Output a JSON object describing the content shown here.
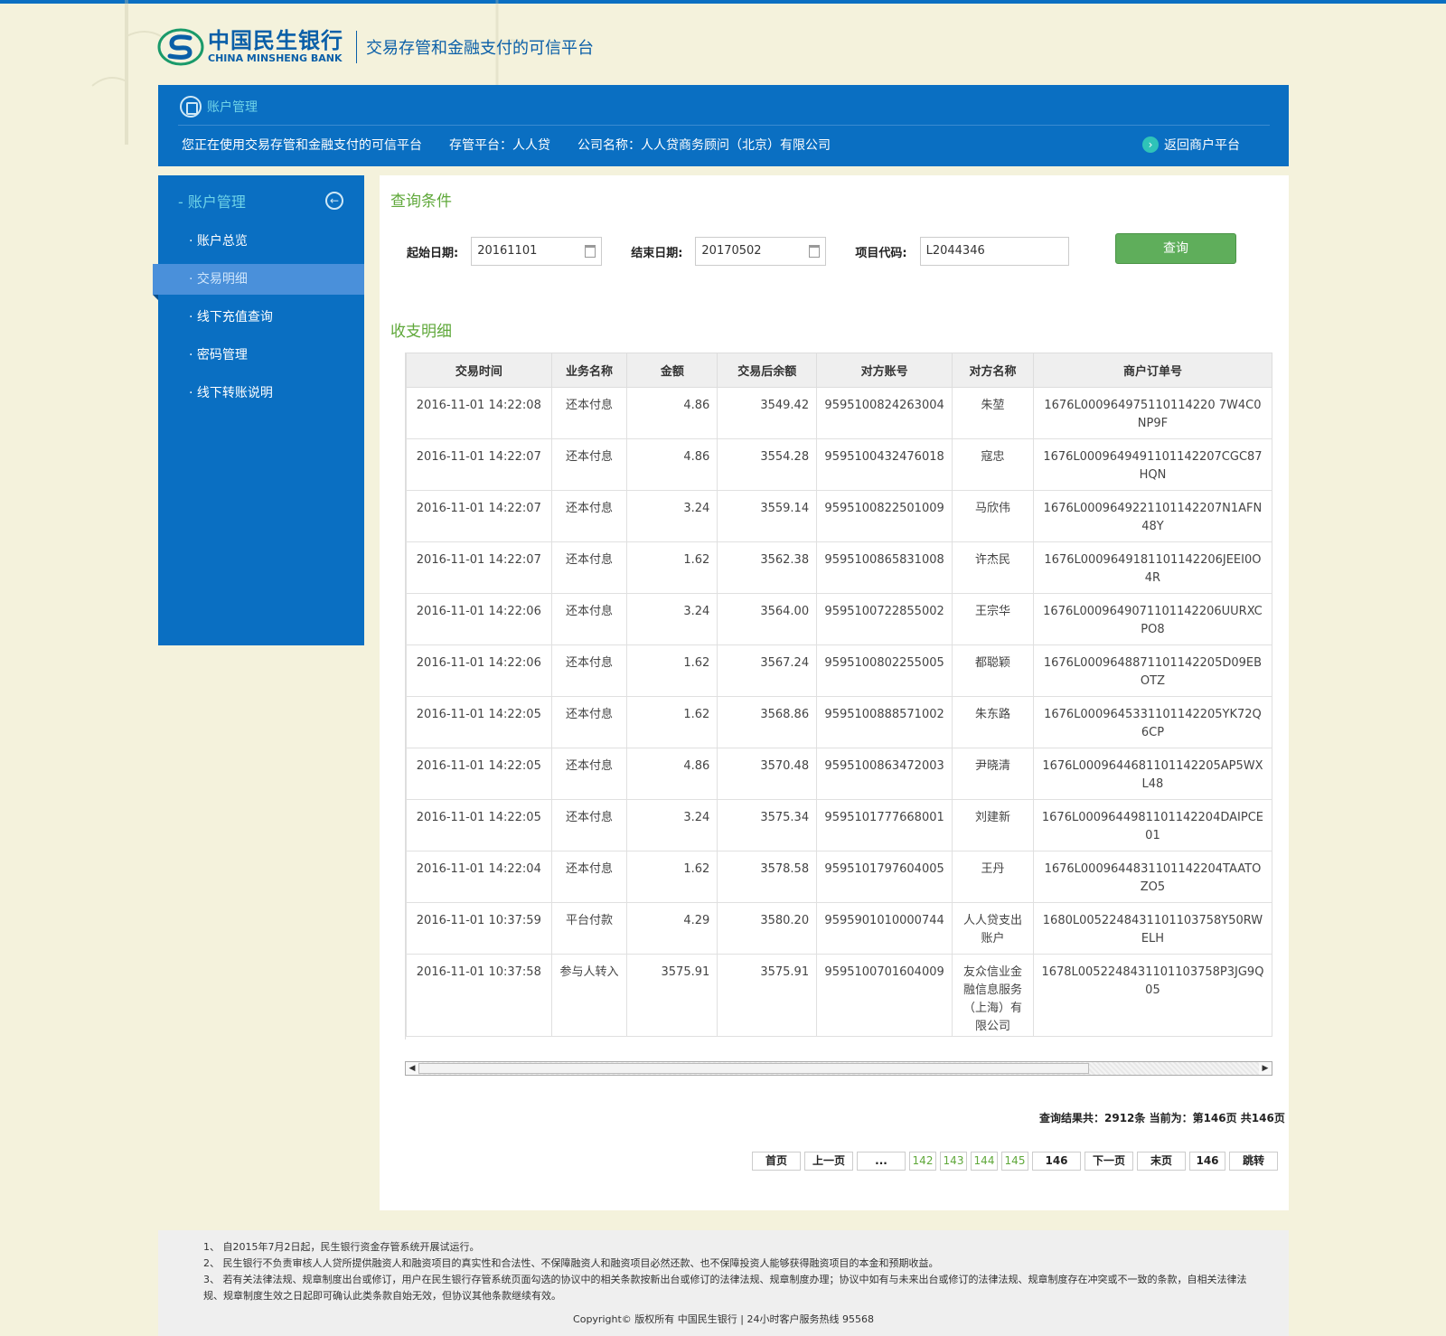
{
  "brand": {
    "name_cn": "中国民生银行",
    "name_en": "CHINA MINSHENG BANK",
    "slogan": "交易存管和金融支付的可信平台"
  },
  "banner": {
    "crumb": "账户管理",
    "notice": "您正在使用交易存管和金融支付的可信平台",
    "platform": "存管平台：人人贷",
    "company": "公司名称：人人贷商务顾问（北京）有限公司",
    "back_label": "返回商户平台"
  },
  "sidebar": {
    "title": "- 账户管理",
    "items": [
      {
        "label": "· 账户总览"
      },
      {
        "label": "· 交易明细"
      },
      {
        "label": "· 线下充值查询"
      },
      {
        "label": "· 密码管理"
      },
      {
        "label": "· 线下转账说明"
      }
    ]
  },
  "query": {
    "title": "查询条件",
    "start_label": "起始日期:",
    "start_value": "20161101",
    "end_label": "结束日期:",
    "end_value": "20170502",
    "code_label": "项目代码:",
    "code_value": "L2044346",
    "button": "查询"
  },
  "detail": {
    "title": "收支明细",
    "columns": [
      "交易时间",
      "业务名称",
      "金额",
      "交易后余额",
      "对方账号",
      "对方名称",
      "商户订单号"
    ],
    "rows": [
      {
        "time": "2016-11-01 14:22:08",
        "biz": "还本付息",
        "amount": "4.86",
        "balance": "3549.42",
        "acct": "9595100824263004",
        "name": "朱堃",
        "order": "1676L000964975110114220 7W4C0NP9F"
      },
      {
        "time": "2016-11-01 14:22:07",
        "biz": "还本付息",
        "amount": "4.86",
        "balance": "3554.28",
        "acct": "9595100432476018",
        "name": "寇忠",
        "order": "1676L0009649491101142207CGC87HQN"
      },
      {
        "time": "2016-11-01 14:22:07",
        "biz": "还本付息",
        "amount": "3.24",
        "balance": "3559.14",
        "acct": "9595100822501009",
        "name": "马欣伟",
        "order": "1676L0009649221101142207N1AFN48Y"
      },
      {
        "time": "2016-11-01 14:22:07",
        "biz": "还本付息",
        "amount": "1.62",
        "balance": "3562.38",
        "acct": "9595100865831008",
        "name": "许杰民",
        "order": "1676L0009649181101142206JEEI0O4R"
      },
      {
        "time": "2016-11-01 14:22:06",
        "biz": "还本付息",
        "amount": "3.24",
        "balance": "3564.00",
        "acct": "9595100722855002",
        "name": "王宗华",
        "order": "1676L0009649071101142206UURXCPO8"
      },
      {
        "time": "2016-11-01 14:22:06",
        "biz": "还本付息",
        "amount": "1.62",
        "balance": "3567.24",
        "acct": "9595100802255005",
        "name": "都聪颖",
        "order": "1676L0009648871101142205D09EBOTZ"
      },
      {
        "time": "2016-11-01 14:22:05",
        "biz": "还本付息",
        "amount": "1.62",
        "balance": "3568.86",
        "acct": "9595100888571002",
        "name": "朱东路",
        "order": "1676L0009645331101142205YK72Q6CP"
      },
      {
        "time": "2016-11-01 14:22:05",
        "biz": "还本付息",
        "amount": "4.86",
        "balance": "3570.48",
        "acct": "9595100863472003",
        "name": "尹晓清",
        "order": "1676L0009644681101142205AP5WXL48"
      },
      {
        "time": "2016-11-01 14:22:05",
        "biz": "还本付息",
        "amount": "3.24",
        "balance": "3575.34",
        "acct": "9595101777668001",
        "name": "刘建新",
        "order": "1676L0009644981101142204DAIPCE01"
      },
      {
        "time": "2016-11-01 14:22:04",
        "biz": "还本付息",
        "amount": "1.62",
        "balance": "3578.58",
        "acct": "9595101797604005",
        "name": "王丹",
        "order": "1676L0009644831101142204TAATOZO5"
      },
      {
        "time": "2016-11-01 10:37:59",
        "biz": "平台付款",
        "amount": "4.29",
        "balance": "3580.20",
        "acct": "9595901010000744",
        "name": "人人贷支出账户",
        "order": "1680L0052248431101103758Y50RWELH"
      },
      {
        "time": "2016-11-01 10:37:58",
        "biz": "参与人转入",
        "amount": "3575.91",
        "balance": "3575.91",
        "acct": "9595100701604009",
        "name": "友众信业金融信息服务（上海）有限公司",
        "order": "1678L0052248431101103758P3JG9Q05"
      }
    ]
  },
  "summary": "查询结果共：2912条  当前为：第146页  共146页",
  "pager": {
    "first": "首页",
    "prev": "上一页",
    "ellipsis": "...",
    "pages": [
      "142",
      "143",
      "144",
      "145"
    ],
    "current": "146",
    "next": "下一页",
    "last": "末页",
    "jump_value": "146",
    "jump": "跳转"
  },
  "footer": {
    "notes": [
      "1、 自2015年7月2日起，民生银行资金存管系统开展试运行。",
      "2、 民生银行不负责审核人人贷所提供融资人和融资项目的真实性和合法性、不保障融资人和融资项目必然还款、也不保障投资人能够获得融资项目的本金和预期收益。",
      "3、 若有关法律法规、规章制度出台或修订，用户在民生银行存管系统页面勾选的协议中的相关条款按新出台或修订的法律法规、规章制度办理；协议中如有与未来出台或修订的法律法规、规章制度存在冲突或不一致的条款，自相关法律法规、规章制度生效之日起即可确认此类条款自始无效，但协议其他条款继续有效。"
    ],
    "copyright": "Copyright© 版权所有 中国民生银行 | 24小时客户服务热线 95568"
  },
  "colors": {
    "brand_blue": "#0a6fc2",
    "accent_green": "#5fa83a",
    "button_green": "#5fae5b",
    "page_bg": "#f4f2dc"
  }
}
